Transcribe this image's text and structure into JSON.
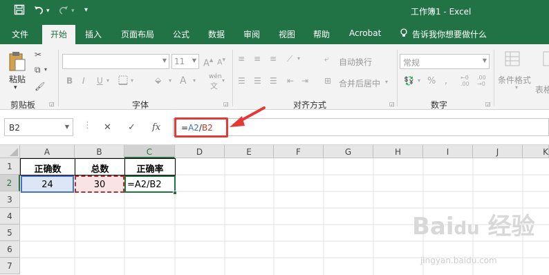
{
  "window": {
    "title": "工作簿1  -  Excel",
    "accent": "#217346"
  },
  "quick_access": {
    "save_icon": "save-icon",
    "undo_icon": "undo-icon",
    "redo_icon": "redo-icon",
    "customize_icon": "customize-icon"
  },
  "tabs": [
    {
      "label": "文件"
    },
    {
      "label": "开始",
      "active": true
    },
    {
      "label": "插入"
    },
    {
      "label": "页面布局"
    },
    {
      "label": "公式"
    },
    {
      "label": "数据"
    },
    {
      "label": "审阅"
    },
    {
      "label": "视图"
    },
    {
      "label": "帮助"
    },
    {
      "label": "Acrobat"
    }
  ],
  "tell_me": "告诉我你想要做什么",
  "ribbon": {
    "clipboard": {
      "paste_label": "粘贴",
      "group_label": "剪贴板"
    },
    "font": {
      "font_name": "",
      "font_size": "11",
      "group_label": "字体",
      "pinyin_label": "wén"
    },
    "alignment": {
      "wrap_text": "自动换行",
      "merge_center": "合并后居中",
      "group_label": "对齐方式"
    },
    "number": {
      "format": "常规",
      "group_label": "数字"
    },
    "styles": {
      "conditional_format": "条件格式",
      "table_format": "表格"
    }
  },
  "formula_bar": {
    "name_box": "B2",
    "fx_label": "fx",
    "formula_parts": [
      {
        "text": "=",
        "color": "#222222"
      },
      {
        "text": "A2",
        "color": "#3b6fc7"
      },
      {
        "text": "/",
        "color": "#222222"
      },
      {
        "text": "B2",
        "color": "#c0392b"
      }
    ]
  },
  "sheet": {
    "columns": [
      "A",
      "B",
      "C",
      "D",
      "E",
      "F",
      "G",
      "H",
      "I",
      "J",
      "K"
    ],
    "rows": [
      "1",
      "2",
      "3",
      "4",
      "5",
      "6",
      "7"
    ],
    "cells": {
      "A1": "正确数",
      "B1": "总数",
      "C1": "正确率",
      "A2": "24",
      "B2": "30",
      "C2": "=A2/B2"
    }
  },
  "watermark": {
    "brand": "Bai du 经验",
    "url": "jingyan.baidu.com"
  }
}
